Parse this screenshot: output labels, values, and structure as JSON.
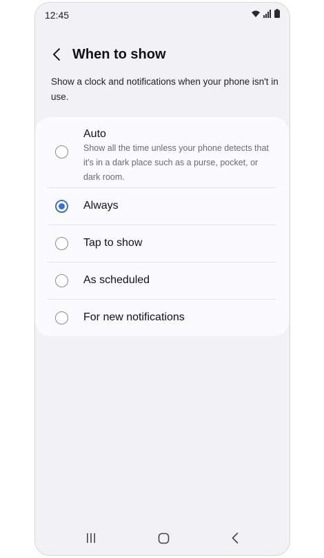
{
  "status_bar": {
    "time": "12:45"
  },
  "header": {
    "title": "When to show"
  },
  "description": "Show a clock and notifications when your phone isn't in use.",
  "options": [
    {
      "label": "Auto",
      "subtitle": "Show all the time unless your phone detects that it's in a dark place such as a purse, pocket, or dark room.",
      "selected": false
    },
    {
      "label": "Always",
      "selected": true
    },
    {
      "label": "Tap to show",
      "selected": false
    },
    {
      "label": "As scheduled",
      "selected": false
    },
    {
      "label": "For new notifications",
      "selected": false
    }
  ],
  "colors": {
    "accent": "#3b6fd8",
    "background": "#f2f2f4",
    "card": "#fbfbfd"
  },
  "icons": {
    "status": [
      "wifi-icon",
      "signal-icon",
      "battery-icon"
    ],
    "nav": [
      "recents-icon",
      "home-icon",
      "back-icon"
    ]
  }
}
